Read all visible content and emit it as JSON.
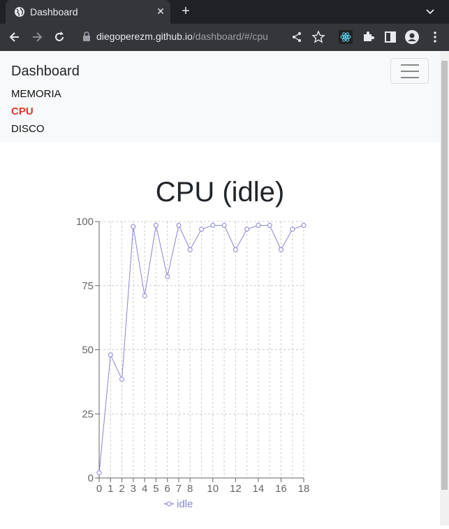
{
  "browser": {
    "tab_title": "Dashboard",
    "url_host": "diegoperezm.github.io",
    "url_path": "/dashboard/#/cpu"
  },
  "navbar": {
    "brand": "Dashboard",
    "links": [
      "MEMORIA",
      "CPU",
      "DISCO"
    ],
    "active": "CPU"
  },
  "chart_title": "CPU (idle)",
  "chart_data": {
    "type": "line",
    "title": "CPU (idle)",
    "x": [
      0,
      1,
      2,
      3,
      4,
      5,
      6,
      7,
      8,
      9,
      10,
      11,
      12,
      13,
      14,
      15,
      16,
      17,
      18
    ],
    "series": [
      {
        "name": "idle",
        "values": [
          2,
          48,
          38.5,
          98,
          71,
          98.5,
          78.5,
          98.5,
          89,
          97,
          98.5,
          98.5,
          89,
          97,
          98.5,
          98.5,
          89,
          97,
          98.5
        ]
      }
    ],
    "xticks": [
      0,
      1,
      2,
      3,
      4,
      5,
      6,
      7,
      8,
      10,
      12,
      14,
      16,
      18
    ],
    "yticks": [
      0,
      25,
      50,
      75,
      100
    ],
    "xlim": [
      0,
      18
    ],
    "ylim": [
      0,
      100
    ],
    "grid": true,
    "legend": "bottom",
    "color": "#8884d8"
  }
}
